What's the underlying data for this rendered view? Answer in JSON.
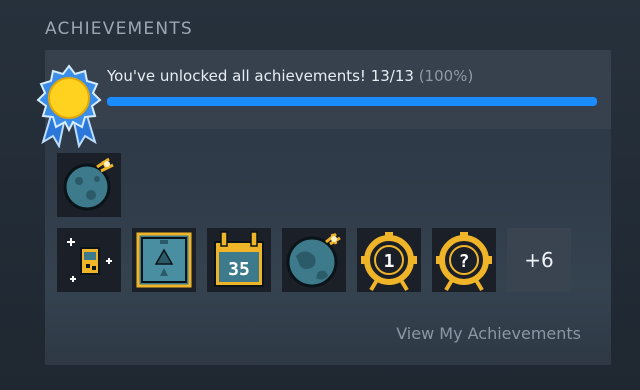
{
  "section": {
    "title": "ACHIEVEMENTS"
  },
  "summary": {
    "message": "You've unlocked all achievements! 13/13",
    "percent_text": "(100%)",
    "progress": 1.0
  },
  "achievements": {
    "featured": [
      {
        "icon": "moon-icon"
      }
    ],
    "row": [
      {
        "icon": "handheld-sparkle-icon"
      },
      {
        "icon": "pyramid-card-icon"
      },
      {
        "icon": "calendar-icon",
        "text": "35"
      },
      {
        "icon": "earth-icon"
      },
      {
        "icon": "medal-icon",
        "text": "1"
      },
      {
        "icon": "medal-icon",
        "text": "?"
      }
    ],
    "more_label": "+6"
  },
  "footer": {
    "view_link": "View My Achievements"
  },
  "colors": {
    "accent": "#1a8cff",
    "gold": "#f0b429",
    "teal": "#3d7a8c"
  }
}
